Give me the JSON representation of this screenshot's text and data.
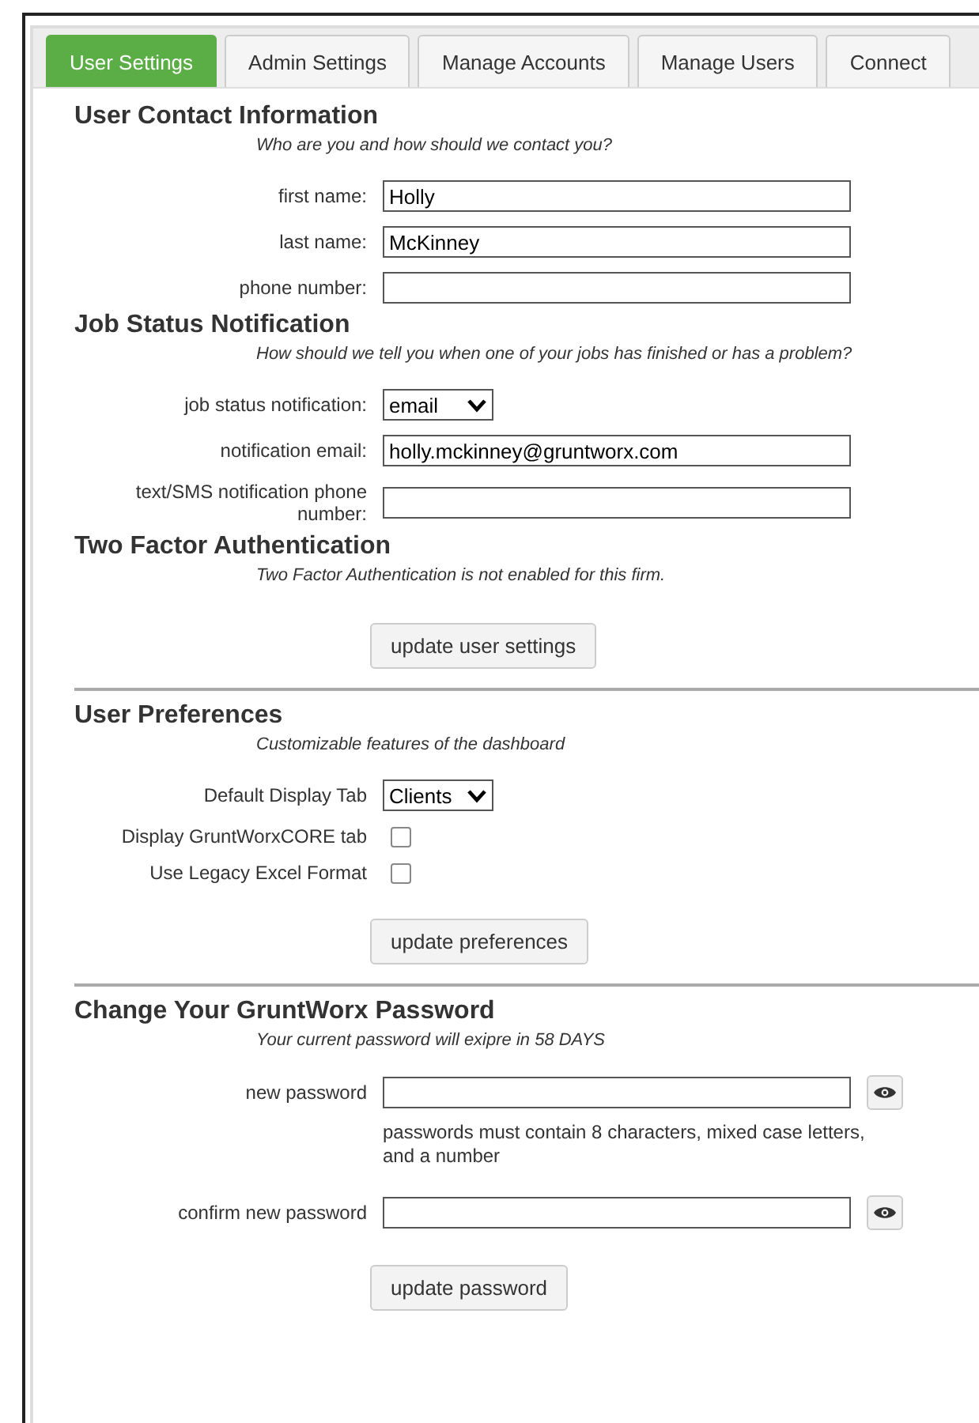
{
  "tabs": [
    {
      "label": "User Settings",
      "selected": true
    },
    {
      "label": "Admin Settings",
      "selected": false
    },
    {
      "label": "Manage Accounts",
      "selected": false
    },
    {
      "label": "Manage Users",
      "selected": false
    },
    {
      "label": "Connect",
      "selected": false
    }
  ],
  "panels": [
    {
      "sections": [
        {
          "title": "User Contact Information",
          "subtitle": "Who are you and how should we contact you?",
          "fields": [
            {
              "kind": "text",
              "label": "first name:",
              "value": "Holly"
            },
            {
              "kind": "text",
              "label": "last name:",
              "value": "McKinney"
            },
            {
              "kind": "text",
              "label": "phone number:"
            }
          ]
        },
        {
          "title": "Job Status Notification",
          "subtitle": "How should we tell you when one of your jobs has finished or has a problem?",
          "fields": [
            {
              "kind": "select",
              "label": "job status notification:",
              "value": "email"
            },
            {
              "kind": "text",
              "label": "notification email:",
              "value": "holly.mckinney@gruntworx.com"
            },
            {
              "kind": "text",
              "label": "text/SMS notification phone number:"
            }
          ]
        },
        {
          "title": "Two Factor Authentication",
          "subtitle": "Two Factor Authentication is not enabled for this firm."
        }
      ],
      "button": "update user settings"
    },
    {
      "sections": [
        {
          "title": "User Preferences",
          "subtitle": "Customizable features of the dashboard",
          "fields": [
            {
              "kind": "select",
              "label": "Default Display Tab",
              "value": "Clients"
            },
            {
              "kind": "checkbox",
              "label": "Display GruntWorxCORE tab",
              "checked": false
            },
            {
              "kind": "checkbox",
              "label": "Use Legacy Excel Format",
              "checked": false
            }
          ]
        }
      ],
      "button": "update preferences"
    },
    {
      "sections": [
        {
          "title": "Change Your GruntWorx Password",
          "subtitle": "Your current password will exipre in 58 DAYS",
          "fields": [
            {
              "kind": "password",
              "label": "new password"
            },
            {
              "kind": "hint",
              "text": "passwords must contain 8 characters, mixed case letters, and a number"
            },
            {
              "kind": "password",
              "label": "confirm new password"
            }
          ]
        }
      ],
      "button": "update password"
    }
  ]
}
